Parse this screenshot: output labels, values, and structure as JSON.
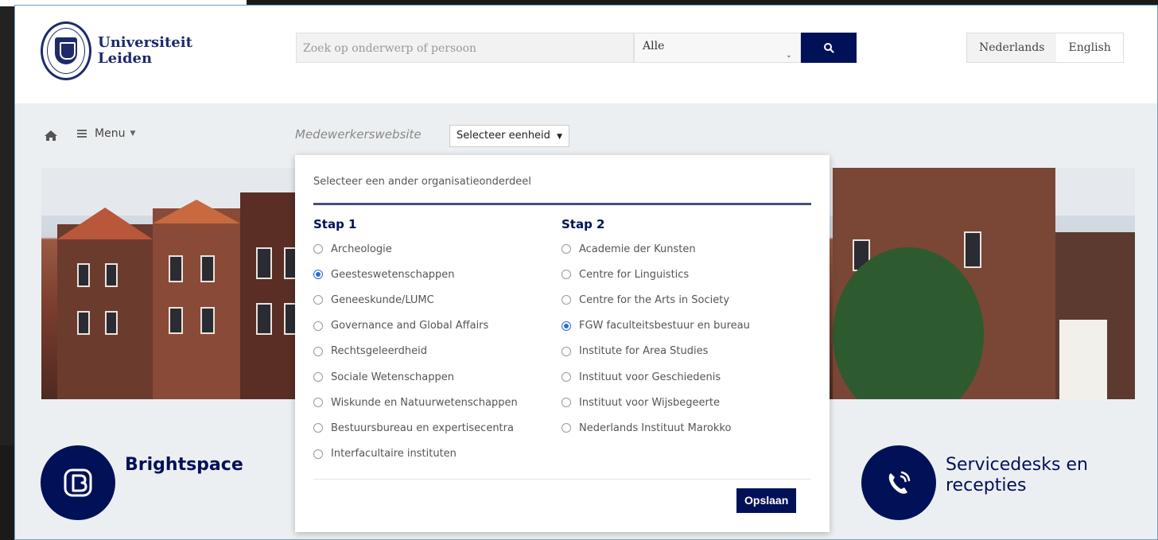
{
  "header": {
    "logo_text_line1": "Universiteit",
    "logo_text_line2": "Leiden",
    "search_placeholder": "Zoek op onderwerp of persoon",
    "search_scope": "Alle",
    "search_button_icon": "search-icon",
    "languages": [
      "Nederlands",
      "English"
    ],
    "active_language": "Nederlands"
  },
  "nav": {
    "home_icon": "home-icon",
    "menu_label": "Menu",
    "site_label": "Medewerkerswebsite",
    "unit_select_label": "Selecteer eenheid"
  },
  "panel": {
    "title": "Selecteer een ander organisatieonderdeel",
    "step1": {
      "heading": "Stap 1",
      "options": [
        {
          "label": "Archeologie",
          "selected": false
        },
        {
          "label": "Geesteswetenschappen",
          "selected": true
        },
        {
          "label": "Geneeskunde/LUMC",
          "selected": false
        },
        {
          "label": "Governance and Global Affairs",
          "selected": false
        },
        {
          "label": "Rechtsgeleerdheid",
          "selected": false
        },
        {
          "label": "Sociale Wetenschappen",
          "selected": false
        },
        {
          "label": "Wiskunde en Natuurwetenschappen",
          "selected": false
        },
        {
          "label": "Bestuursbureau en expertisecentra",
          "selected": false
        },
        {
          "label": "Interfacultaire instituten",
          "selected": false
        }
      ]
    },
    "step2": {
      "heading": "Stap 2",
      "options": [
        {
          "label": "Academie der Kunsten",
          "selected": false
        },
        {
          "label": "Centre for Linguistics",
          "selected": false
        },
        {
          "label": "Centre for the Arts in Society",
          "selected": false
        },
        {
          "label": "FGW faculteitsbestuur en bureau",
          "selected": true
        },
        {
          "label": "Institute for Area Studies",
          "selected": false
        },
        {
          "label": "Instituut voor Geschiedenis",
          "selected": false
        },
        {
          "label": "Instituut voor Wijsbegeerte",
          "selected": false
        },
        {
          "label": "Nederlands Instituut Marokko",
          "selected": false
        }
      ]
    },
    "save_label": "Opslaan"
  },
  "tiles": {
    "left_title": "Brightspace",
    "left_icon": "brightspace-logo-icon",
    "right_title_line1": "Servicedesks en",
    "right_title_line2": "recepties",
    "right_icon": "phone-icon"
  },
  "colors": {
    "brand_navy": "#001158",
    "radio_selected": "#2a6cd7"
  }
}
